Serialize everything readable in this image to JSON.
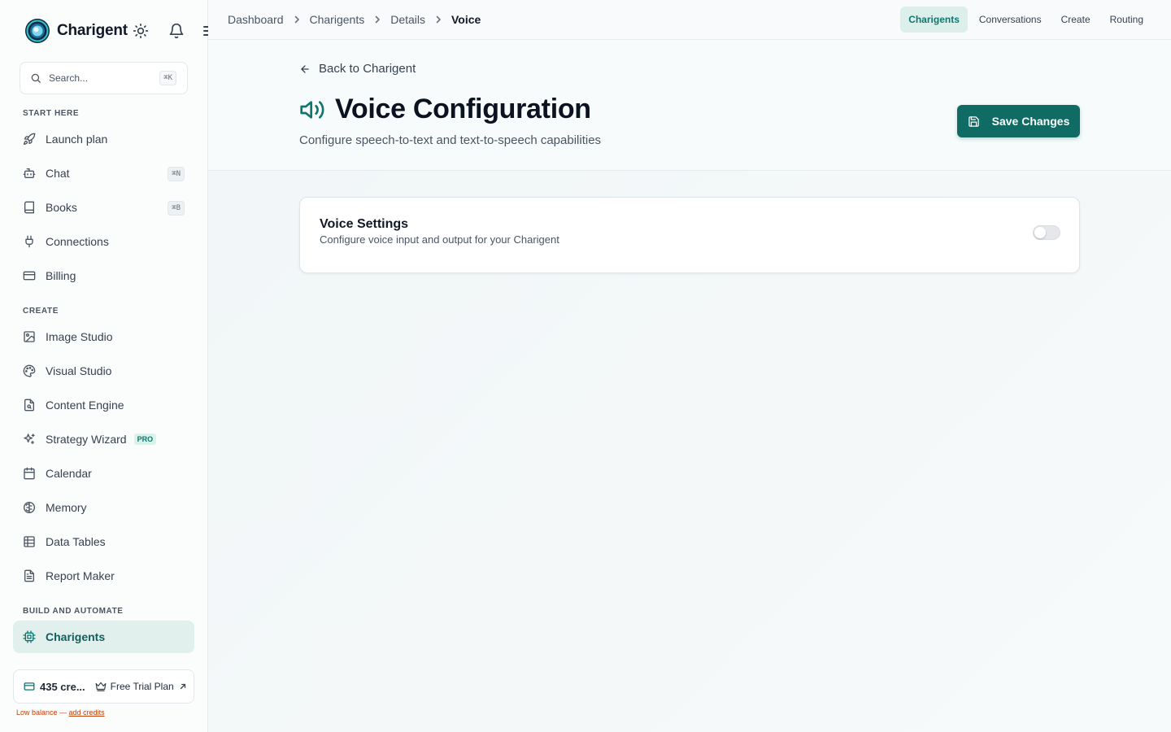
{
  "brand": {
    "name": "Charigent"
  },
  "search": {
    "placeholder": "Search...",
    "shortcut": "⌘K"
  },
  "sidebar": {
    "sections": [
      {
        "title": "START HERE",
        "items": [
          {
            "label": "Launch plan",
            "icon": "rocket-icon"
          },
          {
            "label": "Chat",
            "icon": "bot-icon",
            "shortcut": "⌘N"
          },
          {
            "label": "Books",
            "icon": "book-icon",
            "shortcut": "⌘B"
          },
          {
            "label": "Connections",
            "icon": "plug-icon"
          },
          {
            "label": "Billing",
            "icon": "credit-card-icon"
          }
        ]
      },
      {
        "title": "CREATE",
        "items": [
          {
            "label": "Image Studio",
            "icon": "image-icon"
          },
          {
            "label": "Visual Studio",
            "icon": "palette-icon"
          },
          {
            "label": "Content Engine",
            "icon": "file-search-icon"
          },
          {
            "label": "Strategy Wizard",
            "icon": "sparkles-icon",
            "badge": "PRO"
          },
          {
            "label": "Calendar",
            "icon": "calendar-icon"
          },
          {
            "label": "Memory",
            "icon": "brain-icon"
          },
          {
            "label": "Data Tables",
            "icon": "table-icon"
          },
          {
            "label": "Report Maker",
            "icon": "file-text-icon"
          }
        ]
      },
      {
        "title": "BUILD AND AUTOMATE",
        "items": [
          {
            "label": "Charigents",
            "icon": "cpu-icon",
            "active": true
          }
        ]
      }
    ],
    "credits": {
      "count": "435 cre...",
      "plan": "Free Trial Plan"
    },
    "low_balance": {
      "text": "Low balance — ",
      "link": "add credits"
    }
  },
  "breadcrumb": [
    "Dashboard",
    "Charigents",
    "Details",
    "Voice"
  ],
  "top_nav": [
    {
      "label": "Charigents",
      "active": true
    },
    {
      "label": "Conversations"
    },
    {
      "label": "Create"
    },
    {
      "label": "Routing"
    }
  ],
  "page": {
    "back_label": "Back to Charigent",
    "title": "Voice Configuration",
    "subtitle": "Configure speech-to-text and text-to-speech capabilities",
    "save_label": "Save Changes"
  },
  "voice_settings": {
    "title": "Voice Settings",
    "description": "Configure voice input and output for your Charigent",
    "enabled": false
  },
  "colors": {
    "accent": "#0f766e",
    "button": "#0f6b63",
    "active_bg": "#e2f0ed",
    "warning": "#c2410c"
  }
}
